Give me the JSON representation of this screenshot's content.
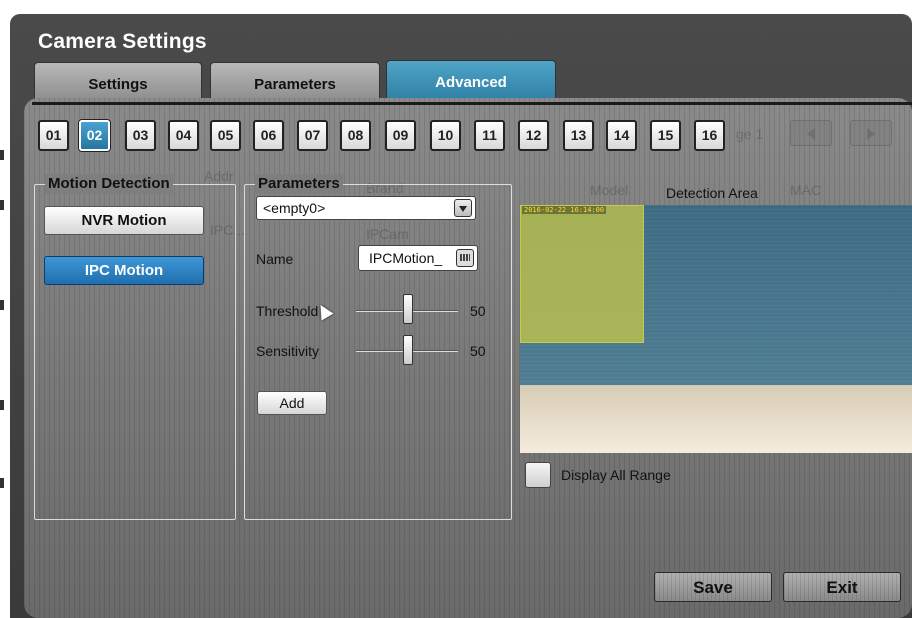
{
  "window": {
    "title": "Camera Settings"
  },
  "tabs": [
    {
      "label": "Settings",
      "active": false
    },
    {
      "label": "Parameters",
      "active": false
    },
    {
      "label": "Advanced",
      "active": true
    }
  ],
  "channels": {
    "items": [
      "01",
      "02",
      "03",
      "04",
      "05",
      "06",
      "07",
      "08",
      "09",
      "10",
      "11",
      "12",
      "13",
      "14",
      "15",
      "16"
    ],
    "selected": "02"
  },
  "motion_detection": {
    "legend": "Motion Detection",
    "buttons": [
      {
        "label": "NVR Motion",
        "active": false
      },
      {
        "label": "IPC Motion",
        "active": true
      }
    ]
  },
  "parameters": {
    "legend": "Parameters",
    "profile_select": {
      "value": "<empty0>",
      "icon": "dropdown-arrow-icon"
    },
    "name_label": "Name",
    "name_value": "IPCMotion_",
    "name_icon": "keyboard-icon",
    "threshold": {
      "label": "Threshold",
      "value": "50",
      "level": 50
    },
    "sensitivity": {
      "label": "Sensitivity",
      "value": "50",
      "level": 50
    },
    "add_label": "Add"
  },
  "detection": {
    "label": "Detection Area",
    "timestamp": "2016-02-22 16:14:00",
    "display_all_range_label": "Display All Range",
    "display_all_range_checked": false
  },
  "footer": {
    "save_label": "Save",
    "exit_label": "Exit"
  },
  "background_ghost": {
    "col_addr": "Addr",
    "col_brand": "Brand",
    "col_model": "Model",
    "col_mac": "MAC",
    "page": "ge 1",
    "row_ip": "IPC...",
    "row_col": "IPCam"
  },
  "colors": {
    "accent": "#2d7ea2",
    "button_blue": "#1f6fb0",
    "detection_area": "#c8c846",
    "timestamp": "#ffdd33"
  }
}
